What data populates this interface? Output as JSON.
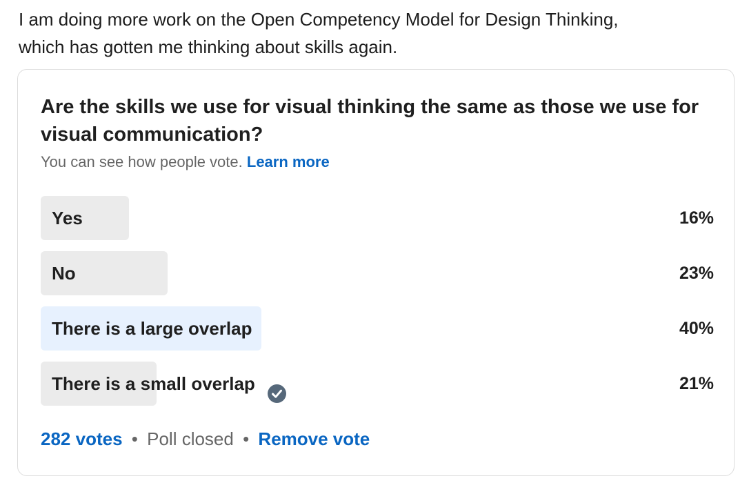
{
  "post": {
    "text_line1": "I am doing more work on the Open Competency Model for Design Thinking,",
    "text_line2": "which has gotten me thinking about skills again."
  },
  "poll": {
    "question": "Are the skills we use for visual thinking the same as those we use for visual communication?",
    "subtitle": "You can see how people vote.",
    "learn_more": "Learn more",
    "options": [
      {
        "label": "Yes",
        "percent": "16%",
        "value": 16
      },
      {
        "label": "No",
        "percent": "23%",
        "value": 23
      },
      {
        "label": "There is a large overlap",
        "percent": "40%",
        "value": 40
      },
      {
        "label": "There is a small overlap",
        "percent": "21%",
        "value": 21
      }
    ],
    "selected_index": 3,
    "winner_index": 2,
    "votes": "282 votes",
    "status": "Poll closed",
    "remove_vote": "Remove vote",
    "separator": "•"
  },
  "colors": {
    "link": "#0a66c2",
    "bar": "#ebebeb",
    "bar_winner": "#e7f1fe",
    "check": "#56687a"
  },
  "icons": {
    "selected": "check-circle-icon"
  }
}
